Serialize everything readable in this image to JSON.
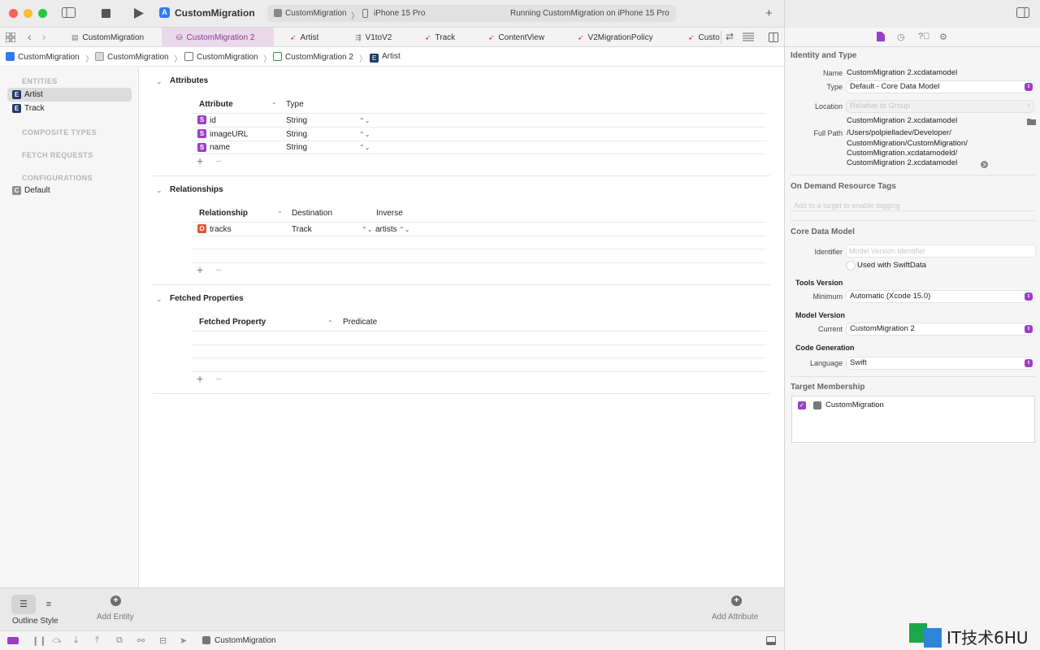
{
  "toolbar": {
    "project_title": "CustomMigration",
    "scheme_name": "CustomMigration",
    "scheme_chevron": "〉",
    "device_name": "iPhone 15 Pro",
    "status_text": "Running CustomMigration on iPhone 15 Pro"
  },
  "tabs": [
    {
      "label": "CustomMigration",
      "icon": "workspace-icon"
    },
    {
      "label": "CustomMigration 2",
      "icon": "data-model-icon"
    },
    {
      "label": "Artist",
      "icon": "swift-icon"
    },
    {
      "label": "V1toV2",
      "icon": "mapping-icon"
    },
    {
      "label": "Track",
      "icon": "swift-icon"
    },
    {
      "label": "ContentView",
      "icon": "swift-icon"
    },
    {
      "label": "V2MigrationPolicy",
      "icon": "swift-icon"
    },
    {
      "label": "Custo",
      "icon": "swift-icon"
    }
  ],
  "breadcrumb": [
    {
      "label": "CustomMigration",
      "icon": "app-icon"
    },
    {
      "label": "CustomMigration",
      "icon": "folder-icon"
    },
    {
      "label": "CustomMigration",
      "icon": "versioned-model-icon"
    },
    {
      "label": "CustomMigration 2",
      "icon": "data-model-icon"
    },
    {
      "label": "Artist",
      "icon": "entity-icon"
    }
  ],
  "sidebar": {
    "entities_header": "ENTITIES",
    "entities": [
      {
        "badge": "E",
        "label": "Artist"
      },
      {
        "badge": "E",
        "label": "Track"
      }
    ],
    "composite_header": "COMPOSITE TYPES",
    "fetch_header": "FETCH REQUESTS",
    "config_header": "CONFIGURATIONS",
    "configurations": [
      {
        "badge": "C",
        "label": "Default"
      }
    ]
  },
  "attributes": {
    "title": "Attributes",
    "col_attribute": "Attribute",
    "col_type": "Type",
    "sort_indicator": "⌃",
    "rows": [
      {
        "badge": "S",
        "name": "id",
        "type": "String"
      },
      {
        "badge": "S",
        "name": "imageURL",
        "type": "String"
      },
      {
        "badge": "S",
        "name": "name",
        "type": "String"
      }
    ]
  },
  "relationships": {
    "title": "Relationships",
    "col_relationship": "Relationship",
    "col_destination": "Destination",
    "col_inverse": "Inverse",
    "sort_indicator": "⌃",
    "rows": [
      {
        "badge": "O",
        "name": "tracks",
        "destination": "Track",
        "inverse": "artists"
      }
    ]
  },
  "fetched": {
    "title": "Fetched Properties",
    "col_property": "Fetched Property",
    "col_predicate": "Predicate",
    "sort_indicator": "⌃"
  },
  "editor_bottom": {
    "outline_style": "Outline Style",
    "add_entity": "Add Entity",
    "add_attribute": "Add Attribute"
  },
  "debugbar": {
    "target": "CustomMigration"
  },
  "inspector": {
    "identity_title": "Identity and Type",
    "name_label": "Name",
    "name_value": "CustomMigration 2.xcdatamodel",
    "type_label": "Type",
    "type_value": "Default - Core Data Model",
    "location_label": "Location",
    "location_value": "Relative to Group",
    "file_name": "CustomMigration 2.xcdatamodel",
    "full_path_label": "Full Path",
    "full_path_lines": [
      "/Users/polpielladev/Developer/",
      "CustomMigration/CustomMigration/",
      "CustomMigration.xcdatamodeld/",
      "CustomMigration 2.xcdatamodel"
    ],
    "odr_title": "On Demand Resource Tags",
    "odr_placeholder": "Add to a target to enable tagging",
    "cdm_title": "Core Data Model",
    "identifier_label": "Identifier",
    "identifier_placeholder": "Model Version Identifier",
    "swiftdata_label": "Used with SwiftData",
    "tools_version_title": "Tools Version",
    "minimum_label": "Minimum",
    "minimum_value": "Automatic (Xcode 15.0)",
    "model_version_title": "Model Version",
    "current_label": "Current",
    "current_value": "CustomMigration 2",
    "codegen_title": "Code Generation",
    "language_label": "Language",
    "language_value": "Swift",
    "target_membership_title": "Target Membership",
    "target_name": "CustomMigration"
  },
  "watermark": {
    "text": "IT技术6HU"
  },
  "colors": {
    "accent": "#9b3ec7",
    "entity_badge": "#1f3b66",
    "relationship_badge": "#e2543a",
    "active_tab_bg": "#ead9ea"
  }
}
